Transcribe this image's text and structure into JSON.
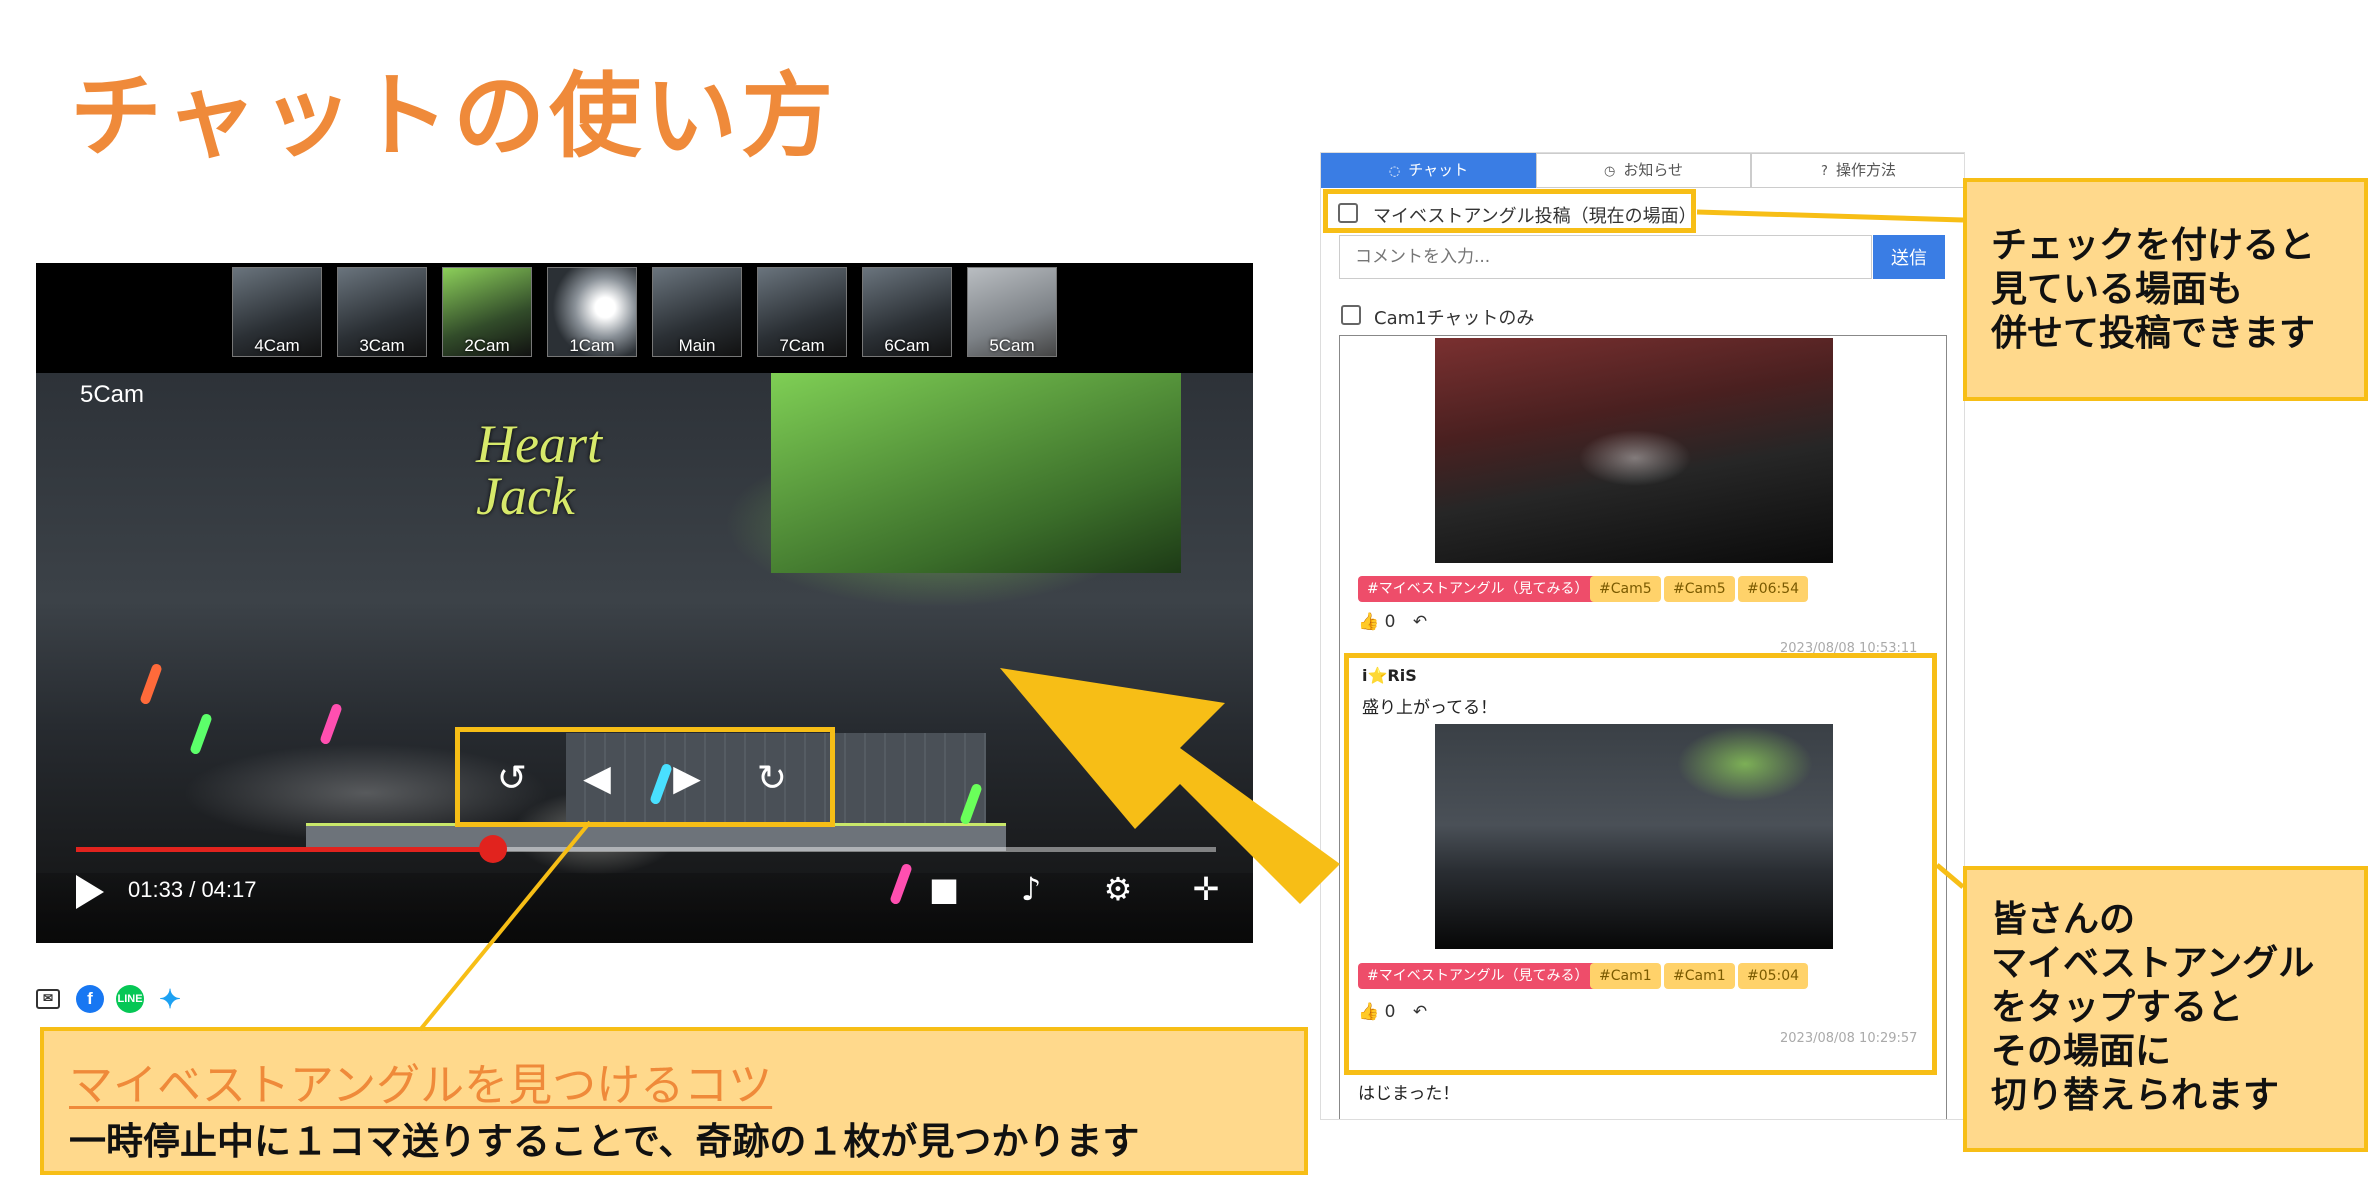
{
  "title": "チャットの使い方",
  "player": {
    "thumbnails": [
      "4Cam",
      "3Cam",
      "2Cam",
      "1Cam",
      "Main",
      "7Cam",
      "6Cam",
      "5Cam"
    ],
    "current_cam": "5Cam",
    "logo_text": "Heart Jack",
    "time_current": "01:33",
    "time_total": "04:17",
    "time_separator": "/",
    "progress": 0.366
  },
  "tip": {
    "title": "マイベストアングルを見つけるコツ",
    "body": "一時停止中に１コマ送りすることで、奇跡の１枚が見つかります"
  },
  "chat": {
    "tabs": [
      "チャット",
      "お知らせ",
      "操作方法"
    ],
    "best_angle_checkbox_label": "マイベストアングル投稿（現在の場面）",
    "comment_placeholder": "コメントを入力...",
    "send_label": "送信",
    "cam1_only_label": "Cam1チャットのみ",
    "posts": [
      {
        "tags": [
          "#マイベストアングル（見てみる）",
          "#Cam5",
          "#Cam5",
          "#06:54"
        ],
        "likes": "0",
        "timestamp": "2023/08/08 10:53:11"
      },
      {
        "user": "i⭐RiS",
        "message": "盛り上がってる！",
        "tags": [
          "#マイベストアングル（見てみる）",
          "#Cam1",
          "#Cam1",
          "#05:04"
        ],
        "likes": "0",
        "timestamp": "2023/08/08 10:29:57"
      },
      {
        "message": "はじまった！"
      }
    ]
  },
  "callouts": {
    "checkbox": [
      "チェックを付けると",
      "見ている場面も",
      "併せて投稿できます"
    ],
    "tap": [
      "皆さんの",
      "マイベストアングル",
      "をタップすると",
      "その場面に",
      "切り替えられます"
    ]
  },
  "colors": {
    "accent_orange": "#ef8a3a",
    "highlight_yellow": "#f7be16",
    "callout_fill": "#ffd98c",
    "chat_blue": "#3a7de4",
    "tag_pink": "#ee4d6a",
    "seek_red": "#e1231e"
  }
}
